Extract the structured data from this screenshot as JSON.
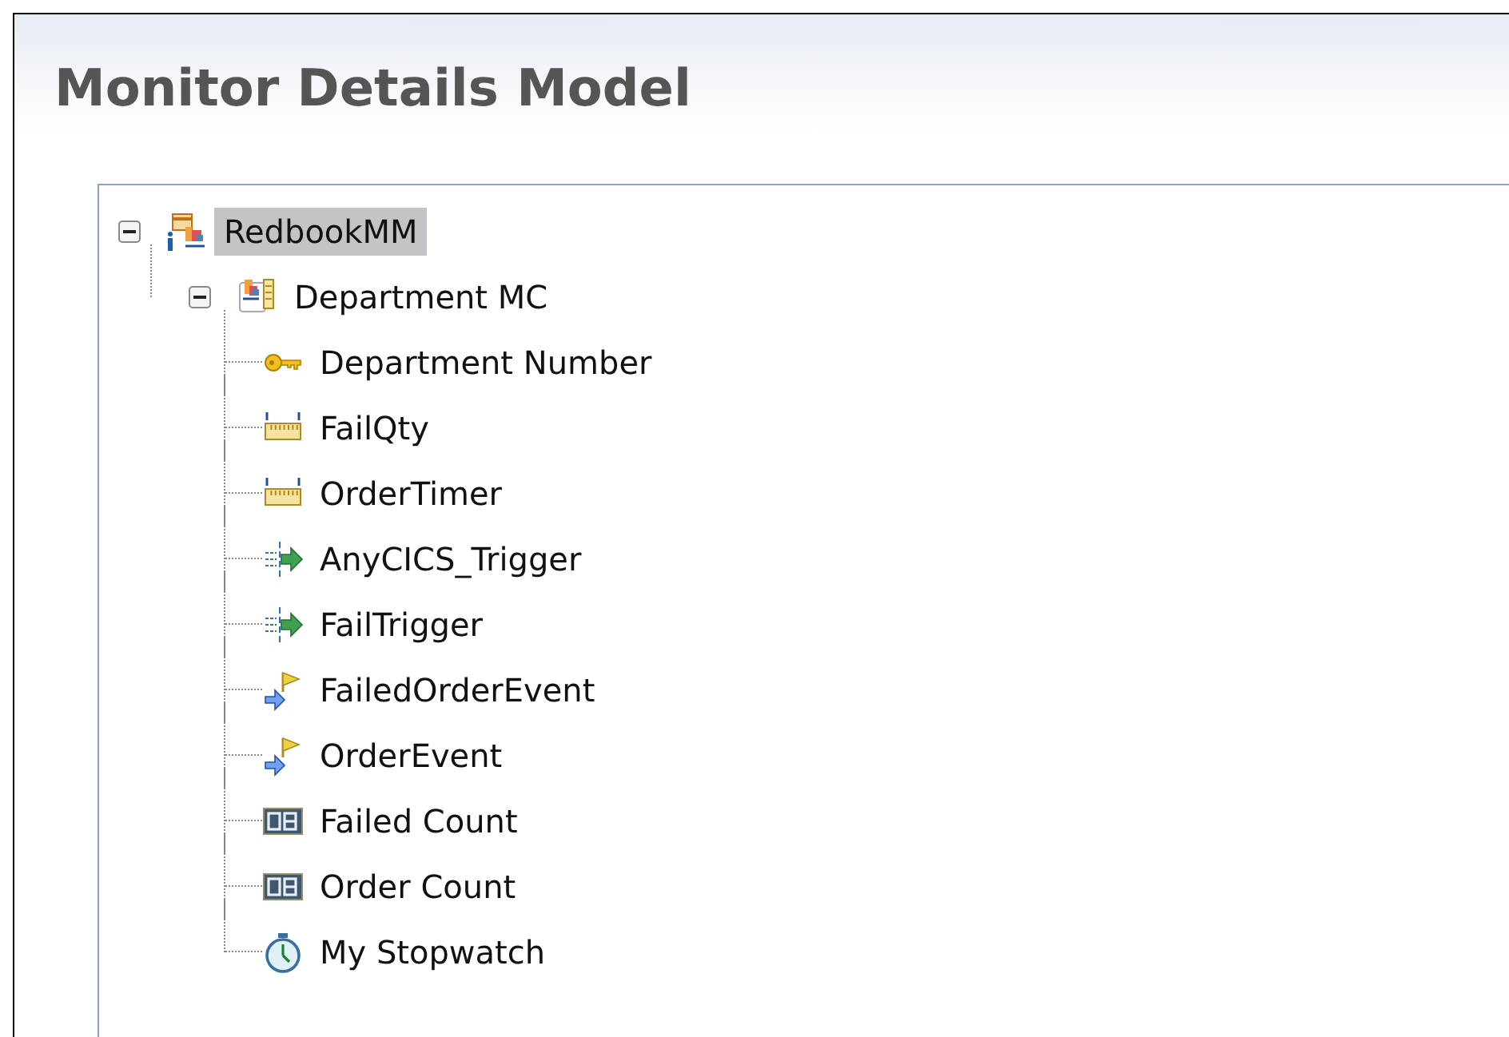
{
  "title": "Monitor Details Model",
  "tree": [
    {
      "label": "RedbookMM",
      "kind": "model",
      "selected": true,
      "expanded": true,
      "children": [
        {
          "label": "Department MC",
          "kind": "context",
          "selected": false,
          "expanded": true,
          "children": [
            {
              "label": "Department Number",
              "kind": "key",
              "selected": false
            },
            {
              "label": "FailQty",
              "kind": "metric",
              "selected": false
            },
            {
              "label": "OrderTimer",
              "kind": "metric",
              "selected": false
            },
            {
              "label": "AnyCICS_Trigger",
              "kind": "trigger",
              "selected": false
            },
            {
              "label": "FailTrigger",
              "kind": "trigger",
              "selected": false
            },
            {
              "label": "FailedOrderEvent",
              "kind": "event",
              "selected": false
            },
            {
              "label": "OrderEvent",
              "kind": "event",
              "selected": false
            },
            {
              "label": "Failed Count",
              "kind": "counter",
              "selected": false
            },
            {
              "label": "Order Count",
              "kind": "counter",
              "selected": false
            },
            {
              "label": "My Stopwatch",
              "kind": "stopwatch",
              "selected": false
            }
          ]
        }
      ]
    }
  ]
}
